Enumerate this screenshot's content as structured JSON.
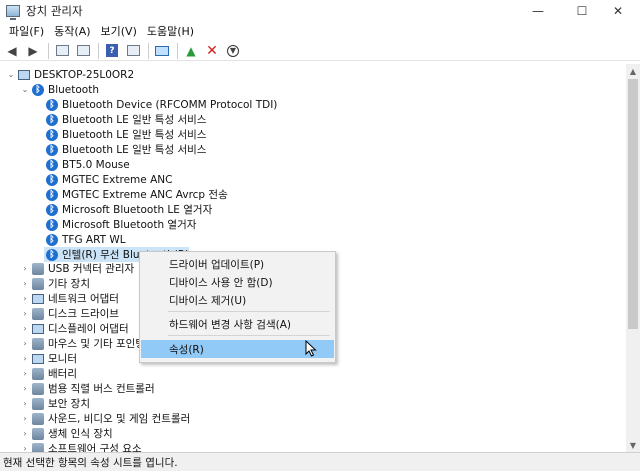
{
  "window": {
    "title": "장치 관리자",
    "minimize": "—",
    "maximize": "☐",
    "close": "✕"
  },
  "menu": [
    "파일(F)",
    "동작(A)",
    "보기(V)",
    "도움말(H)"
  ],
  "toolbar": {
    "icons": [
      "back-arrow-icon",
      "forward-arrow-icon",
      "properties-view-icon",
      "list-view-icon",
      "help-icon",
      "scan-hardware-icon",
      "enable-device-icon",
      "uninstall-icon",
      "update-driver-icon"
    ]
  },
  "tree": {
    "root": "DESKTOP-25L0OR2",
    "bluetooth_category": "Bluetooth",
    "bluetooth_devices": [
      "Bluetooth Device (RFCOMM Protocol TDI)",
      "Bluetooth LE 일반 특성 서비스",
      "Bluetooth LE 일반 특성 서비스",
      "Bluetooth LE 일반 특성 서비스",
      "BT5.0 Mouse",
      "MGTEC Extreme ANC",
      "MGTEC Extreme ANC Avrcp 전송",
      "Microsoft Bluetooth LE 열거자",
      "Microsoft Bluetooth 열거자",
      "TFG ART WL",
      "인텔(R) 무선 Bluetooth(R)"
    ],
    "categories": [
      "USB 커넥터 관리자",
      "기타 장치",
      "네트워크 어댑터",
      "디스크 드라이브",
      "디스플레이 어댑터",
      "마우스 및 기타 포인팅 장치",
      "모니터",
      "배터리",
      "범용 직렬 버스 컨트롤러",
      "보안 장치",
      "사운드, 비디오 및 게임 컨트롤러",
      "생체 인식 장치",
      "소프트웨어 구성 요소"
    ]
  },
  "context_menu": {
    "update_driver": "드라이버 업데이트(P)",
    "disable_device": "디바이스 사용 안 함(D)",
    "uninstall_device": "디바이스 제거(U)",
    "scan_hardware": "하드웨어 변경 사항 검색(A)",
    "properties": "속성(R)"
  },
  "status": "현재 선택한 항목의 속성 시트를 엽니다.",
  "colors": {
    "bluetooth": "#1f6fd1",
    "selection": "#cce4f7",
    "menu_hover": "#91c9f7"
  }
}
